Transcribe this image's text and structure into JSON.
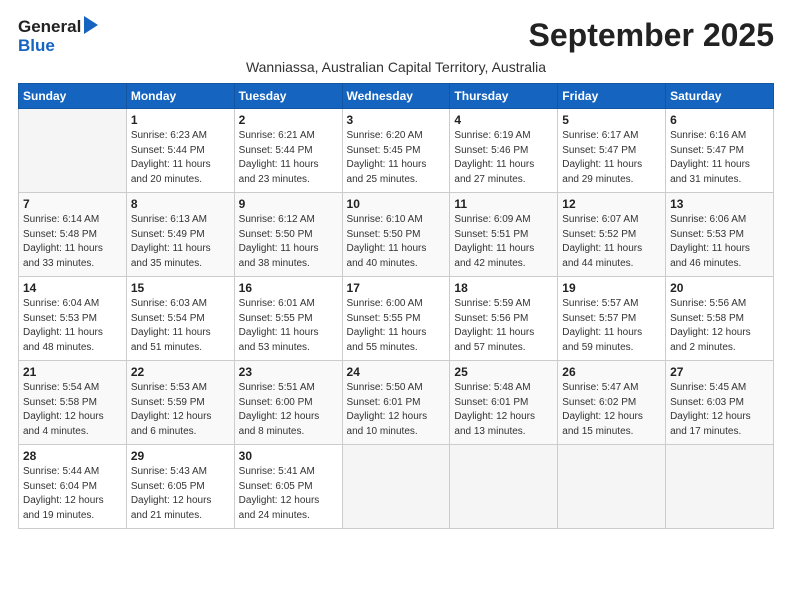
{
  "header": {
    "logo_general": "General",
    "logo_blue": "Blue",
    "month": "September 2025",
    "location": "Wanniassa, Australian Capital Territory, Australia"
  },
  "days_of_week": [
    "Sunday",
    "Monday",
    "Tuesday",
    "Wednesday",
    "Thursday",
    "Friday",
    "Saturday"
  ],
  "weeks": [
    [
      {
        "day": "",
        "info": ""
      },
      {
        "day": "1",
        "info": "Sunrise: 6:23 AM\nSunset: 5:44 PM\nDaylight: 11 hours\nand 20 minutes."
      },
      {
        "day": "2",
        "info": "Sunrise: 6:21 AM\nSunset: 5:44 PM\nDaylight: 11 hours\nand 23 minutes."
      },
      {
        "day": "3",
        "info": "Sunrise: 6:20 AM\nSunset: 5:45 PM\nDaylight: 11 hours\nand 25 minutes."
      },
      {
        "day": "4",
        "info": "Sunrise: 6:19 AM\nSunset: 5:46 PM\nDaylight: 11 hours\nand 27 minutes."
      },
      {
        "day": "5",
        "info": "Sunrise: 6:17 AM\nSunset: 5:47 PM\nDaylight: 11 hours\nand 29 minutes."
      },
      {
        "day": "6",
        "info": "Sunrise: 6:16 AM\nSunset: 5:47 PM\nDaylight: 11 hours\nand 31 minutes."
      }
    ],
    [
      {
        "day": "7",
        "info": "Sunrise: 6:14 AM\nSunset: 5:48 PM\nDaylight: 11 hours\nand 33 minutes."
      },
      {
        "day": "8",
        "info": "Sunrise: 6:13 AM\nSunset: 5:49 PM\nDaylight: 11 hours\nand 35 minutes."
      },
      {
        "day": "9",
        "info": "Sunrise: 6:12 AM\nSunset: 5:50 PM\nDaylight: 11 hours\nand 38 minutes."
      },
      {
        "day": "10",
        "info": "Sunrise: 6:10 AM\nSunset: 5:50 PM\nDaylight: 11 hours\nand 40 minutes."
      },
      {
        "day": "11",
        "info": "Sunrise: 6:09 AM\nSunset: 5:51 PM\nDaylight: 11 hours\nand 42 minutes."
      },
      {
        "day": "12",
        "info": "Sunrise: 6:07 AM\nSunset: 5:52 PM\nDaylight: 11 hours\nand 44 minutes."
      },
      {
        "day": "13",
        "info": "Sunrise: 6:06 AM\nSunset: 5:53 PM\nDaylight: 11 hours\nand 46 minutes."
      }
    ],
    [
      {
        "day": "14",
        "info": "Sunrise: 6:04 AM\nSunset: 5:53 PM\nDaylight: 11 hours\nand 48 minutes."
      },
      {
        "day": "15",
        "info": "Sunrise: 6:03 AM\nSunset: 5:54 PM\nDaylight: 11 hours\nand 51 minutes."
      },
      {
        "day": "16",
        "info": "Sunrise: 6:01 AM\nSunset: 5:55 PM\nDaylight: 11 hours\nand 53 minutes."
      },
      {
        "day": "17",
        "info": "Sunrise: 6:00 AM\nSunset: 5:55 PM\nDaylight: 11 hours\nand 55 minutes."
      },
      {
        "day": "18",
        "info": "Sunrise: 5:59 AM\nSunset: 5:56 PM\nDaylight: 11 hours\nand 57 minutes."
      },
      {
        "day": "19",
        "info": "Sunrise: 5:57 AM\nSunset: 5:57 PM\nDaylight: 11 hours\nand 59 minutes."
      },
      {
        "day": "20",
        "info": "Sunrise: 5:56 AM\nSunset: 5:58 PM\nDaylight: 12 hours\nand 2 minutes."
      }
    ],
    [
      {
        "day": "21",
        "info": "Sunrise: 5:54 AM\nSunset: 5:58 PM\nDaylight: 12 hours\nand 4 minutes."
      },
      {
        "day": "22",
        "info": "Sunrise: 5:53 AM\nSunset: 5:59 PM\nDaylight: 12 hours\nand 6 minutes."
      },
      {
        "day": "23",
        "info": "Sunrise: 5:51 AM\nSunset: 6:00 PM\nDaylight: 12 hours\nand 8 minutes."
      },
      {
        "day": "24",
        "info": "Sunrise: 5:50 AM\nSunset: 6:01 PM\nDaylight: 12 hours\nand 10 minutes."
      },
      {
        "day": "25",
        "info": "Sunrise: 5:48 AM\nSunset: 6:01 PM\nDaylight: 12 hours\nand 13 minutes."
      },
      {
        "day": "26",
        "info": "Sunrise: 5:47 AM\nSunset: 6:02 PM\nDaylight: 12 hours\nand 15 minutes."
      },
      {
        "day": "27",
        "info": "Sunrise: 5:45 AM\nSunset: 6:03 PM\nDaylight: 12 hours\nand 17 minutes."
      }
    ],
    [
      {
        "day": "28",
        "info": "Sunrise: 5:44 AM\nSunset: 6:04 PM\nDaylight: 12 hours\nand 19 minutes."
      },
      {
        "day": "29",
        "info": "Sunrise: 5:43 AM\nSunset: 6:05 PM\nDaylight: 12 hours\nand 21 minutes."
      },
      {
        "day": "30",
        "info": "Sunrise: 5:41 AM\nSunset: 6:05 PM\nDaylight: 12 hours\nand 24 minutes."
      },
      {
        "day": "",
        "info": ""
      },
      {
        "day": "",
        "info": ""
      },
      {
        "day": "",
        "info": ""
      },
      {
        "day": "",
        "info": ""
      }
    ]
  ]
}
